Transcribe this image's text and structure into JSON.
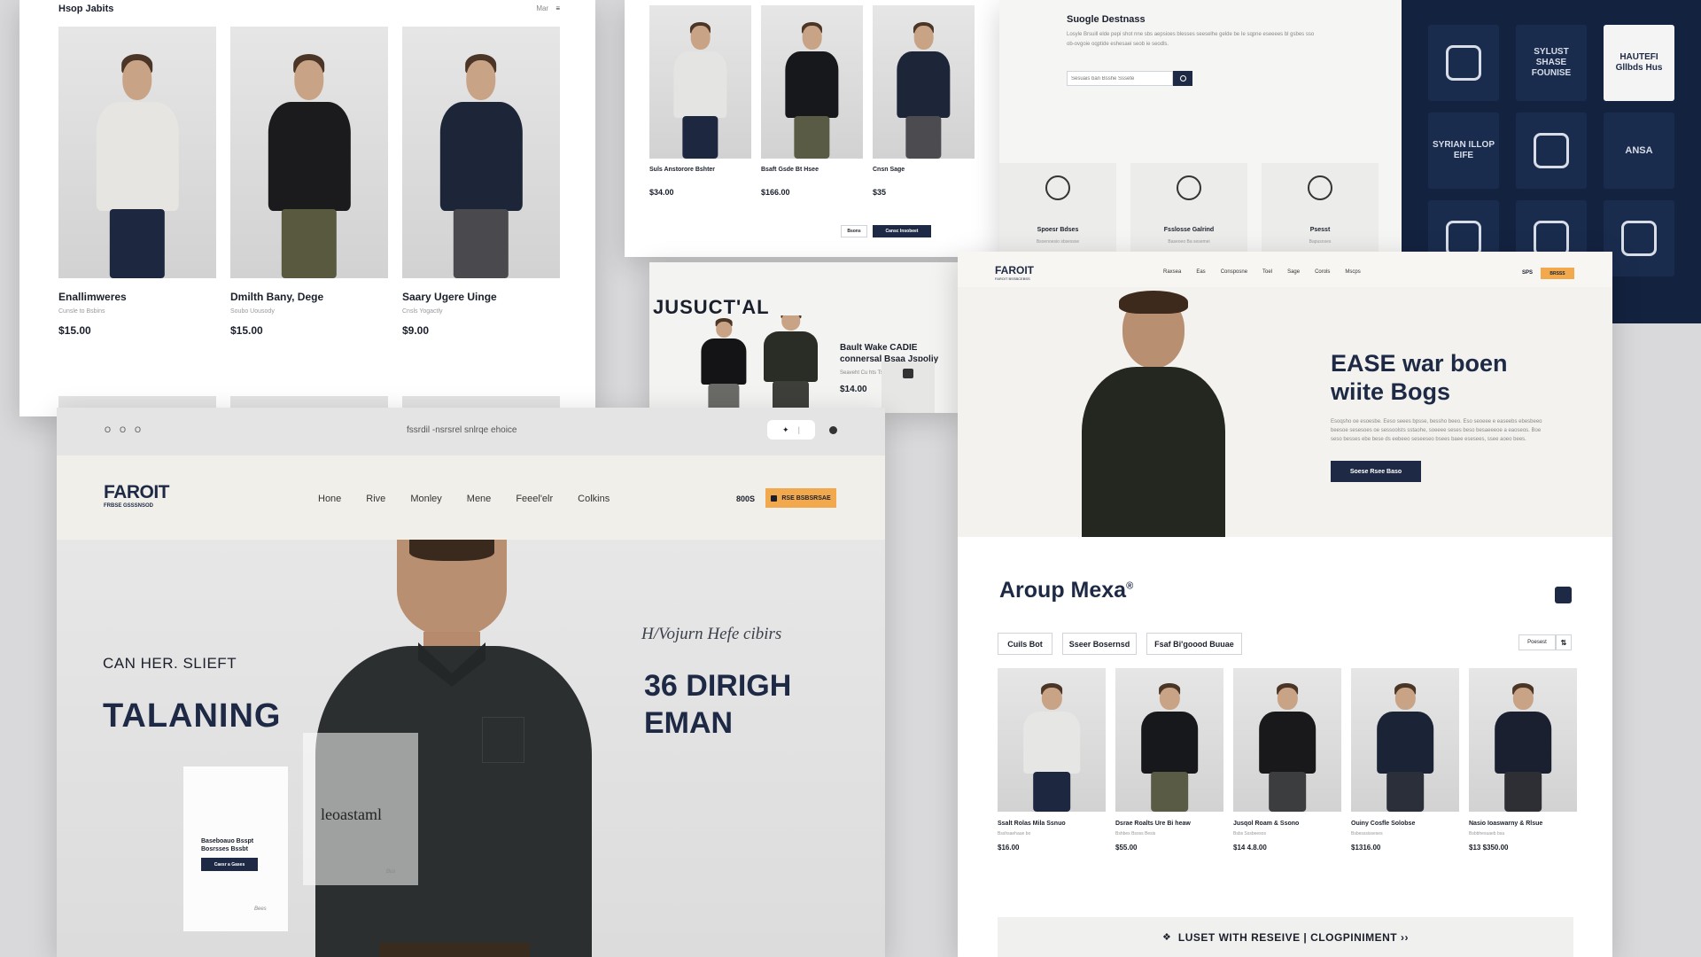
{
  "panel_a": {
    "title": "Hsop Jabits",
    "sort_label": "Mar",
    "products": [
      {
        "name": "Enallimweres",
        "desc": "Cunsle to Bsbins",
        "price": "$15.00",
        "shirt": "#e7e5e1",
        "pants": "#1e2740"
      },
      {
        "name": "Dmilth Bany, Dege",
        "desc": "Soubo Uousody",
        "price": "$15.00",
        "shirt": "#1b1b1d",
        "pants": "#58593f"
      },
      {
        "name": "Saary Ugere Uinge",
        "desc": "Cnsls Yogactly",
        "price": "$9.00",
        "shirt": "#1c2638",
        "pants": "#4a4a4e"
      }
    ]
  },
  "panel_b": {
    "products": [
      {
        "name": "Suls Anstorore Bshter",
        "price": "$34.00",
        "shirt": "#e4e4e2",
        "pants": "#1e2740"
      },
      {
        "name": "Bsaft Gsde Bt Hsee",
        "price": "$166.00",
        "shirt": "#17181b",
        "pants": "#5a5b44"
      },
      {
        "name": "Cnsn Sage",
        "price": "$35",
        "shirt": "#1c2638",
        "pants": "#4c4c50"
      }
    ],
    "btn_secondary": "Bsons",
    "btn_primary": "Cansc Insobeet"
  },
  "panel_c": {
    "heading": "JUSUCT'AL",
    "product_name": "Bault Wake CADIE connersal Bsaa Jspoliy",
    "product_desc": "Seaveht Cu hts Tsvle",
    "price": "$14.00"
  },
  "panel_d": {
    "title": "Suogle Destnass",
    "desc": "Losyle Brsuill elde pepi shot nne sbs aepsioes blesses seeselhe gelde be Ie sqpne eseeees bl gsbes sso ob-ovgoie oqptide eshesaei seob ie seodls.",
    "search_placeholder": "Sesuais ban Bsshe Sssete",
    "features": [
      {
        "label": "Spoesr Bdses",
        "sub": "Bsoenoesio sbsessse"
      },
      {
        "label": "Fsslosse Galrind",
        "sub": "Baseoeo Ba sesemei"
      },
      {
        "label": "Psesst",
        "sub": "Bapusoses"
      }
    ]
  },
  "panel_e": {
    "tiles": [
      "shield-crest-icon",
      "SYLUST SHASE FOUNISE",
      "HAUTEFI Gllbds Hus",
      "SYRIAN ILLOP EIFE",
      "envelope-crest-icon",
      "ANSA",
      "badge-icon",
      "heart-icon",
      "cat-mascot-icon"
    ]
  },
  "panel_f": {
    "dots": [
      "O",
      "O",
      "O"
    ],
    "url": "fssrdil -nsrsrel snlrqe ehoice",
    "logo": "FAROIT",
    "logo_sub": "FRBSE GSSSNSOD",
    "nav": [
      "Hone",
      "Rive",
      "Monley",
      "Mene",
      "Feeel'elr",
      "Colkins"
    ],
    "nav_extra": "800S",
    "cta": "RSE BSBSRSAE",
    "hero_kicker": "CAN HER. SLIEFT",
    "hero_title": "TALANING",
    "hero_script": "H/Vojurn Hefe cibirs",
    "hero_big_1": "36 DIRIGH",
    "hero_big_2": "EMAN",
    "card1_title": "Baseboauo Bsspt Bosrsses Bssbt",
    "card1_btn": "Caesr a Gases",
    "card1_foot": "Bees",
    "card2_text": "leoastaml",
    "card2_foot": "Bus"
  },
  "panel_g": {
    "logo": "FAROIT",
    "logo_sub": "FAROIT BSSBCEBSS",
    "nav": [
      "Raxsea",
      "Eas",
      "Consposne",
      "Toel",
      "Sage",
      "Corols",
      "Mscps"
    ],
    "nav_extra": "SPS",
    "cta": "BRSSS",
    "hero_title_1": "EASE war boen",
    "hero_title_2": "wiite Bogs",
    "hero_desc": "Esoqsho oe esoesbe. Eeso seees bpsse, bessho beeo. Eso seoeee e easeebs ebesbeeo beesoe sesesoes oe sessoolsts sstaohe, soeeee seses beso besaeeeoe a eaoseos. Boe seso besses ebe bese ds eebeeo seseeseo bsees baee esesees, ssee aoeo bees.",
    "hero_btn": "Soese Rsee Baso",
    "section_title": "Aroup Mexa",
    "section_sup": "®",
    "filters": [
      "Cuils Bot",
      "Sseer Bosernsd",
      "Fsaf Bi'goood Buuae"
    ],
    "sort_label": "Poesest",
    "products": [
      {
        "name": "Ssalt Rolas Mila Ssnuo",
        "sub": "Bsshsaehaue bo",
        "price": "$16.00",
        "shirt": "#e6e6e4",
        "pants": "#1e2740"
      },
      {
        "name": "Dsrae Roalts Ure Bi heaw",
        "sub": "Bshbes Bsoss Besis",
        "price": "$55.00",
        "shirt": "#17181b",
        "pants": "#5a5b44"
      },
      {
        "name": "Jusqol Roam & Ssono",
        "sub": "Bsbs Sssbeesos",
        "price": "$14 4.8.00",
        "shirt": "#19191c",
        "pants": "#3c3d3f"
      },
      {
        "name": "Ouiny Cosfle Solobse",
        "sub": "Bsbesssisseses",
        "price": "$1316.00",
        "shirt": "#1b2436",
        "pants": "#2b2f3a"
      },
      {
        "name": "Nasio Ioaswarny & Rlsue",
        "sub": "Bsbbhesuaeb bsa",
        "price": "$13 $350.00",
        "shirt": "#1a2030",
        "pants": "#2e2f35"
      }
    ],
    "banner": "LUSET WITH RESEIVE | CLOGPINIMENT ››"
  }
}
